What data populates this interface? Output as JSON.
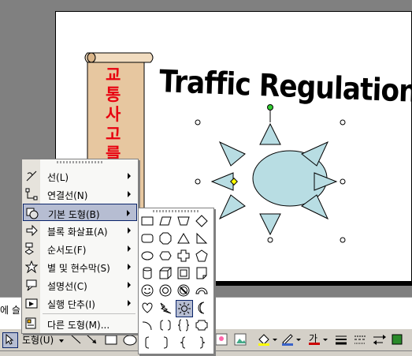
{
  "slide": {
    "title": "Traffic Regulation",
    "scroll_text": "교통사고를"
  },
  "notes": {
    "text": "에 슬"
  },
  "menu": {
    "items": [
      {
        "label": "선(L)",
        "icon": "line-tool-icon"
      },
      {
        "label": "연결선(N)",
        "icon": "connector-icon"
      },
      {
        "label": "기본 도형(B)",
        "icon": "basic-shapes-icon"
      },
      {
        "label": "블록 화살표(A)",
        "icon": "block-arrows-icon"
      },
      {
        "label": "순서도(F)",
        "icon": "flowchart-icon"
      },
      {
        "label": "별 및 현수막(S)",
        "icon": "stars-banners-icon"
      },
      {
        "label": "설명선(C)",
        "icon": "callouts-icon"
      },
      {
        "label": "실행 단추(I)",
        "icon": "action-buttons-icon"
      },
      {
        "label": "다른 도형(M)...",
        "icon": "more-shapes-icon"
      }
    ]
  },
  "toolbar": {
    "autoshapes_label": "도형(U)",
    "font_color_glyph": "가",
    "accent_color": "#cc0000"
  },
  "colors": {
    "sun_fill": "#b8dde3",
    "menu_highlight": "#b6bdd2",
    "scroll_text": "#e8000f"
  }
}
